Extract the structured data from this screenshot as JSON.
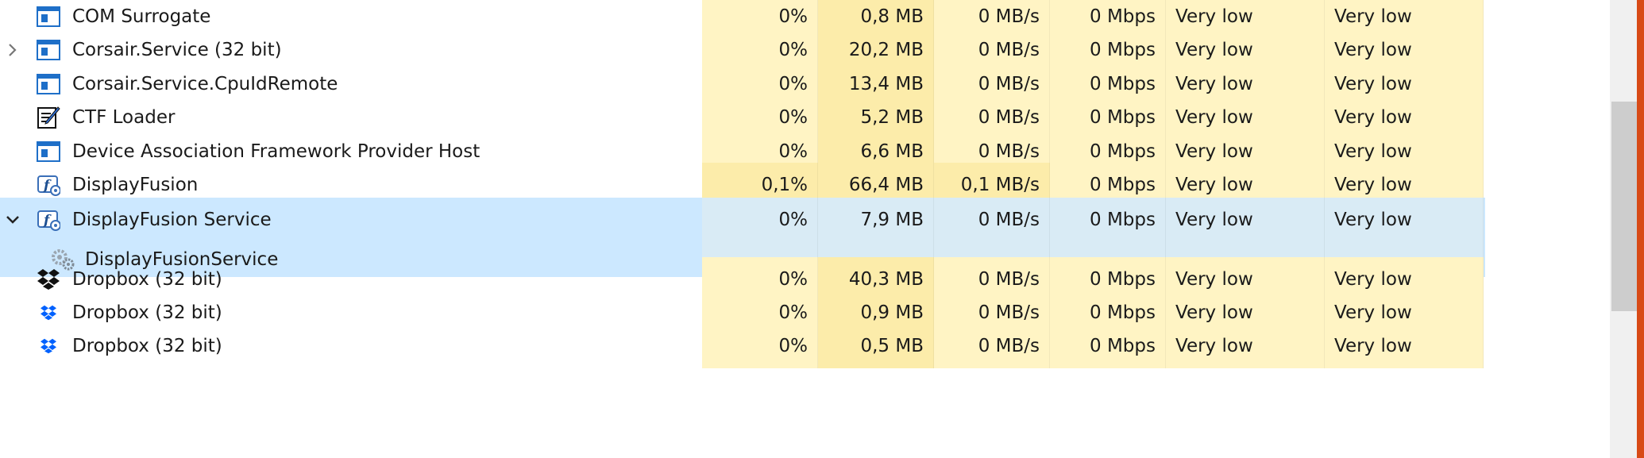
{
  "colors": {
    "selection": "#cce8ff",
    "heat_low": "#fff4c4",
    "heat_medium": "#fcecaa",
    "heat_high": "#f9e396",
    "selected_heat": "#d9ebf5",
    "accent": "#d84a16"
  },
  "rows": [
    {
      "name": "COM Surrogate",
      "icon": "window-app-icon",
      "cpu": "0%",
      "memory": "0,8 MB",
      "disk": "0 MB/s",
      "network": "0 Mbps",
      "power_usage": "Very low",
      "power_usage_trend": "Very low"
    },
    {
      "name": "Corsair.Service (32 bit)",
      "icon": "window-app-icon",
      "expander": "collapsed",
      "cpu": "0%",
      "memory": "20,2 MB",
      "disk": "0 MB/s",
      "network": "0 Mbps",
      "power_usage": "Very low",
      "power_usage_trend": "Very low"
    },
    {
      "name": "Corsair.Service.CpuIdRemote",
      "icon": "window-app-icon",
      "cpu": "0%",
      "memory": "13,4 MB",
      "disk": "0 MB/s",
      "network": "0 Mbps",
      "power_usage": "Very low",
      "power_usage_trend": "Very low"
    },
    {
      "name": "CTF Loader",
      "icon": "ctf-loader-icon",
      "cpu": "0%",
      "memory": "5,2 MB",
      "disk": "0 MB/s",
      "network": "0 Mbps",
      "power_usage": "Very low",
      "power_usage_trend": "Very low"
    },
    {
      "name": "Device Association Framework Provider Host",
      "icon": "window-app-icon",
      "cpu": "0%",
      "memory": "6,6 MB",
      "disk": "0 MB/s",
      "network": "0 Mbps",
      "power_usage": "Very low",
      "power_usage_trend": "Very low"
    },
    {
      "name": "DisplayFusion",
      "icon": "displayfusion-icon",
      "cpu": "0,1%",
      "memory": "66,4 MB",
      "disk": "0,1 MB/s",
      "network": "0 Mbps",
      "power_usage": "Very low",
      "power_usage_trend": "Very low"
    },
    {
      "name": "DisplayFusion Service",
      "icon": "displayfusion-icon",
      "expander": "expanded",
      "selected": true,
      "cpu": "0%",
      "memory": "7,9 MB",
      "disk": "0 MB/s",
      "network": "0 Mbps",
      "power_usage": "Very low",
      "power_usage_trend": "Very low"
    },
    {
      "name": "DisplayFusionService",
      "icon": "service-gear-icon",
      "child": true,
      "selected": true
    },
    {
      "name": "Dropbox (32 bit)",
      "icon": "dropbox-black-icon",
      "cpu": "0%",
      "memory": "40,3 MB",
      "disk": "0 MB/s",
      "network": "0 Mbps",
      "power_usage": "Very low",
      "power_usage_trend": "Very low"
    },
    {
      "name": "Dropbox (32 bit)",
      "icon": "dropbox-blue-icon",
      "cpu": "0%",
      "memory": "0,9 MB",
      "disk": "0 MB/s",
      "network": "0 Mbps",
      "power_usage": "Very low",
      "power_usage_trend": "Very low"
    },
    {
      "name": "Dropbox (32 bit)",
      "icon": "dropbox-blue-icon",
      "cpu": "0%",
      "memory": "0,5 MB",
      "disk": "0 MB/s",
      "network": "0 Mbps",
      "power_usage": "Very low",
      "power_usage_trend": "Very low"
    }
  ]
}
